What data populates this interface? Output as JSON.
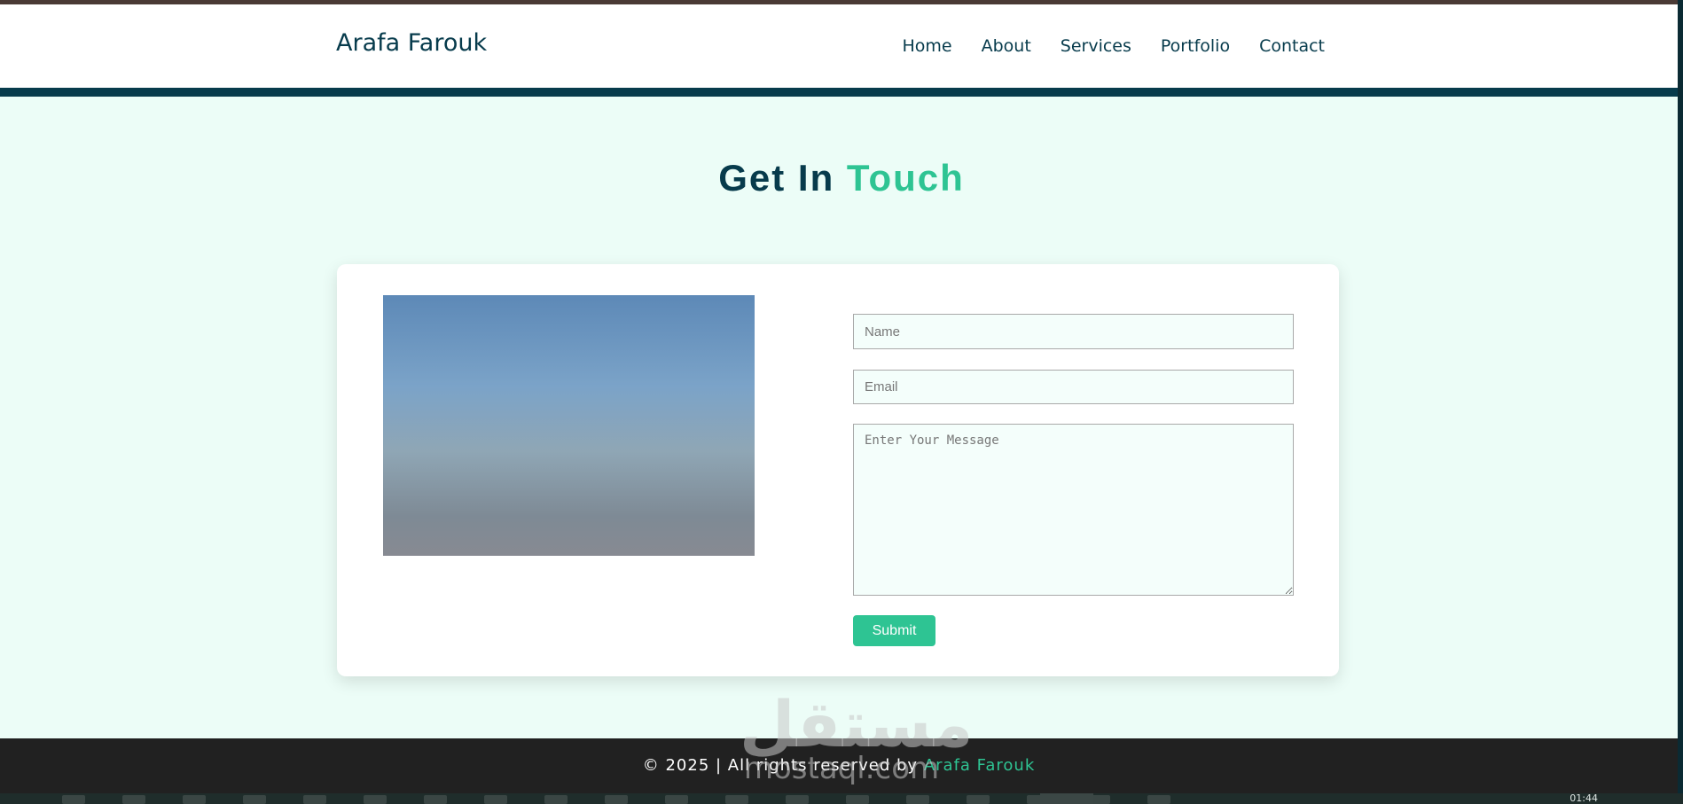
{
  "header": {
    "logo": "Arafa Farouk",
    "nav": [
      {
        "label": "Home"
      },
      {
        "label": "About"
      },
      {
        "label": "Services"
      },
      {
        "label": "Portfolio"
      },
      {
        "label": "Contact"
      }
    ]
  },
  "contact": {
    "heading_main": "Get In",
    "heading_accent": "Touch",
    "form": {
      "name_placeholder": "Name",
      "email_placeholder": "Email",
      "message_placeholder": "Enter Your Message",
      "submit_label": "Submit"
    }
  },
  "footer": {
    "text": "© 2025 | All rights reserved by",
    "accent": "Arafa Farouk"
  },
  "watermark": {
    "logo": "مستقل",
    "site": "mostaql.com"
  },
  "taskbar": {
    "clock": "01:44"
  },
  "colors": {
    "primary": "#073b4c",
    "accent": "#2ec493",
    "background": "#ecfdf7",
    "footer": "#212121"
  }
}
